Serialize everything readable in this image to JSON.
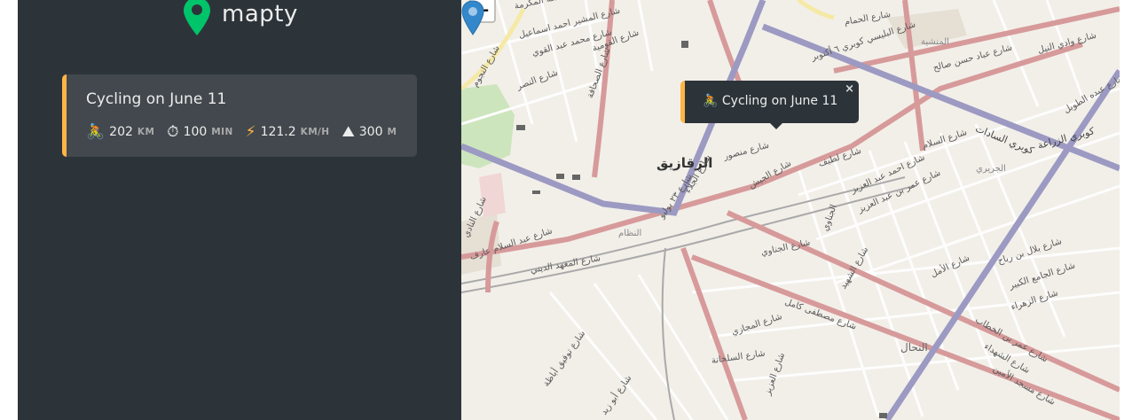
{
  "app": {
    "logo_text": "mapty"
  },
  "colors": {
    "sidebar_bg": "#2d3439",
    "card_bg": "#42484d",
    "cycling_accent": "#ffb545",
    "logo_green": "#00c46a",
    "marker_blue": "#3388cc"
  },
  "workouts": [
    {
      "title": "Cycling on June 11",
      "details": [
        {
          "icon": "🚴",
          "icon_name": "cyclist-icon",
          "value": "202",
          "unit": "km"
        },
        {
          "icon": "⏱",
          "icon_name": "stopwatch-icon",
          "value": "100",
          "unit": "min"
        },
        {
          "icon": "⚡",
          "icon_name": "lightning-icon",
          "value": "121.2",
          "unit": "km/h"
        },
        {
          "icon": "⛰",
          "icon_name": "mountain-icon",
          "value": "300",
          "unit": "m"
        }
      ]
    }
  ],
  "map": {
    "zoom_out_label": "−",
    "popup": {
      "icon": "🚴",
      "text": "Cycling on June 11",
      "close": "×"
    },
    "labels": {
      "city": "الزقازيق",
      "l1": "شارع مكة المكرمة",
      "l2": "شارع المشير احمد اسماعيل",
      "l3": "شارع محمد عبد القوي",
      "l4": "شارع النجوم",
      "l5": "شارع النصر",
      "l6": "شارع الصحافة",
      "l7": "شارع الحمام",
      "l8": "شارع البليسي كوبري ٦ أكتوبر",
      "l9": "المنشية",
      "l10": "شارع عباد حسن صالح",
      "l11": "كوبري السادات",
      "l12": "كوبري الزراعة",
      "l13": "شارع السلام",
      "l14": "الجريري",
      "l15": "شارع لطيف",
      "l16": "شارع احمد عبد العزيز",
      "l17": "شارع عمر بن عبد العزيز",
      "l18": "شارع منصور",
      "l19": "النظام",
      "l20": "شارع عبد السلام عارف",
      "l21": "شارع المعهد الديني",
      "l22": "شارع الجناوي",
      "l23": "شارع الشهيد",
      "l24": "شارع مصطفى كامل",
      "l25": "شارع المجازي",
      "l26": "شارع السلخانة",
      "l27": "شارع العزيز",
      "l28": "شارع الأمل",
      "l29": "النحال",
      "l30": "شارع عمر بن الخطاب",
      "l31": "شارع الشهداء",
      "l32": "شارع مسجد الأمين",
      "l33": "شارع بلال بن رباح",
      "l34": "شارع الزهراء",
      "l35": "شارع توفيق أباظة",
      "l36": "شارع أبو زيد",
      "l37": "الجناوي",
      "l38": "شارع الجامع الكبير",
      "l39": "شارع ٢٣ يوليو",
      "l40": "شارع الجيش",
      "l41": "شارع القومية",
      "l42": "شارع الجلاء",
      "l43": "شارع النادي",
      "l44": "شارع وادي النيل",
      "l45": "شارع عبده الطوبل"
    }
  }
}
